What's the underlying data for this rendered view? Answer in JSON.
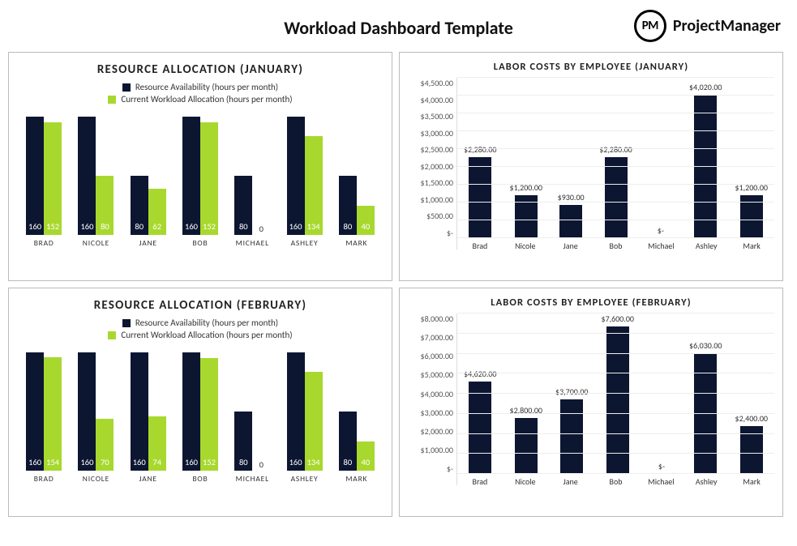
{
  "page_title": "Workload Dashboard Template",
  "brand": {
    "logo_text": "PM",
    "name": "ProjectManager"
  },
  "employees": [
    "Brad",
    "Nicole",
    "Jane",
    "Bob",
    "Michael",
    "Ashley",
    "Mark"
  ],
  "employees_upper": [
    "BRAD",
    "NICOLE",
    "JANE",
    "BOB",
    "MICHAEL",
    "ASHLEY",
    "MARK"
  ],
  "legend": {
    "series1": "Resource Availability (hours per month)",
    "series2": "Current Workload Allocation (hours per month)"
  },
  "chart_data": [
    {
      "id": "alloc_jan",
      "type": "bar",
      "title": "RESOURCE ALLOCATION (JANUARY)",
      "categories": [
        "BRAD",
        "NICOLE",
        "JANE",
        "BOB",
        "MICHAEL",
        "ASHLEY",
        "MARK"
      ],
      "series": [
        {
          "name": "Resource Availability (hours per month)",
          "values": [
            160,
            160,
            80,
            160,
            80,
            160,
            80
          ]
        },
        {
          "name": "Current Workload Allocation (hours per month)",
          "values": [
            152,
            80,
            62,
            152,
            0,
            134,
            40
          ]
        }
      ],
      "ylim": [
        0,
        170
      ]
    },
    {
      "id": "cost_jan",
      "type": "bar",
      "title": "LABOR COSTS BY EMPLOYEE (JANUARY)",
      "categories": [
        "Brad",
        "Nicole",
        "Jane",
        "Bob",
        "Michael",
        "Ashley",
        "Mark"
      ],
      "values": [
        2280,
        1200,
        930,
        2280,
        0,
        4020,
        1200
      ],
      "value_labels": [
        "$2,280.00",
        "$1,200.00",
        "$930.00",
        "$2,280.00",
        "$-",
        "$4,020.00",
        "$1,200.00"
      ],
      "y_ticks": [
        0,
        500,
        1000,
        1500,
        2000,
        2500,
        3000,
        3500,
        4000,
        4500
      ],
      "y_tick_labels": [
        "$-",
        "$500.00",
        "$1,000.00",
        "$1,500.00",
        "$2,000.00",
        "$2,500.00",
        "$3,000.00",
        "$3,500.00",
        "$4,000.00",
        "$4,500.00"
      ],
      "ylim": [
        0,
        4500
      ]
    },
    {
      "id": "alloc_feb",
      "type": "bar",
      "title": "RESOURCE ALLOCATION (FEBRUARY)",
      "categories": [
        "BRAD",
        "NICOLE",
        "JANE",
        "BOB",
        "MICHAEL",
        "ASHLEY",
        "MARK"
      ],
      "series": [
        {
          "name": "Resource Availability (hours per month)",
          "values": [
            160,
            160,
            160,
            160,
            80,
            160,
            80
          ]
        },
        {
          "name": "Current Workload Allocation (hours per month)",
          "values": [
            154,
            70,
            74,
            152,
            0,
            134,
            40
          ]
        }
      ],
      "ylim": [
        0,
        170
      ]
    },
    {
      "id": "cost_feb",
      "type": "bar",
      "title": "LABOR COSTS BY EMPLOYEE (FEBRUARY)",
      "categories": [
        "Brad",
        "Nicole",
        "Jane",
        "Bob",
        "Michael",
        "Ashley",
        "Mark"
      ],
      "values": [
        4620,
        2800,
        3700,
        7600,
        0,
        6030,
        2400
      ],
      "value_labels": [
        "$4,620.00",
        "$2,800.00",
        "$3,700.00",
        "$7,600.00",
        "$-",
        "$6,030.00",
        "$2,400.00"
      ],
      "y_ticks": [
        0,
        1000,
        2000,
        3000,
        4000,
        5000,
        6000,
        7000,
        8000
      ],
      "y_tick_labels": [
        "$-",
        "$1,000.00",
        "$2,000.00",
        "$3,000.00",
        "$4,000.00",
        "$5,000.00",
        "$6,000.00",
        "$7,000.00",
        "$8,000.00"
      ],
      "ylim": [
        0,
        8000
      ]
    }
  ]
}
